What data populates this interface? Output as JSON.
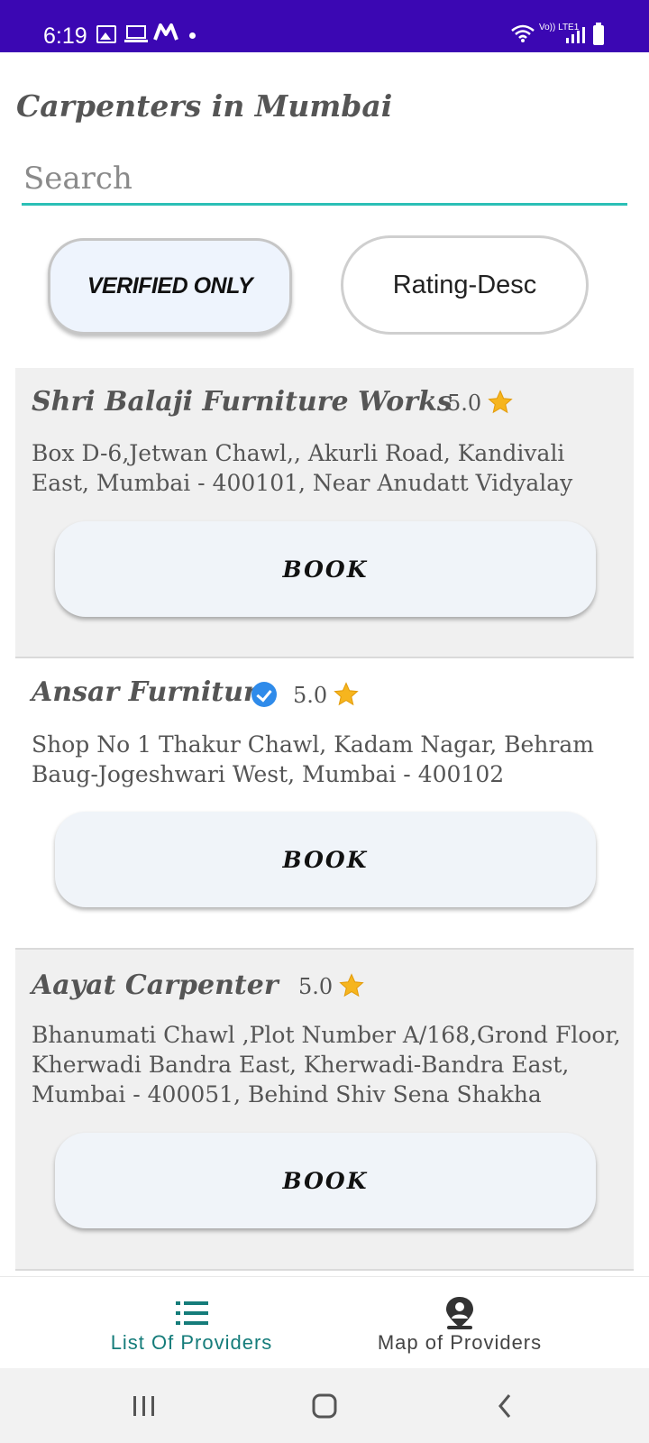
{
  "status_bar": {
    "time": "6:19",
    "icons": [
      "gallery-icon",
      "laptop-icon",
      "m-app-icon",
      "dot-icon",
      "wifi-icon",
      "volte-icon",
      "signal-icon",
      "battery-icon"
    ],
    "volte_text": "Vo)) LTE1"
  },
  "page": {
    "title": "Carpenters in Mumbai"
  },
  "search": {
    "placeholder": "Search",
    "value": ""
  },
  "filters": {
    "verified_label": "VERIFIED ONLY",
    "sort_label": "Rating-Desc"
  },
  "providers": [
    {
      "name": "Shri Balaji Furniture Works",
      "verified": false,
      "rating": "5.0",
      "address": "Box D-6,Jetwan Chawl,, Akurli Road, Kandivali East, Mumbai - 400101, Near Anudatt Vidyalay",
      "book_label": "BOOK"
    },
    {
      "name": "Ansar Furniture",
      "verified": true,
      "rating": "5.0",
      "address": "Shop No 1 Thakur Chawl, Kadam Nagar, Behram Baug-Jogeshwari West, Mumbai - 400102",
      "book_label": "BOOK"
    },
    {
      "name": "Aayat Carpenter",
      "verified": false,
      "rating": "5.0",
      "address": "Bhanumati Chawl ,Plot Number A/168,Grond Floor, Kherwadi Bandra East, Kherwadi-Bandra East, Mumbai - 400051, Behind Shiv Sena Shakha",
      "book_label": "BOOK"
    }
  ],
  "bottom_nav": {
    "list_label": "List Of Providers",
    "map_label": "Map of Providers",
    "active": "List Of Providers"
  },
  "colors": {
    "status_bar": "#3b07b3",
    "accent_teal": "#2bbfb6",
    "active_nav": "#157c7a",
    "star": "#f6b51e",
    "verified_badge": "#2f8bea"
  }
}
